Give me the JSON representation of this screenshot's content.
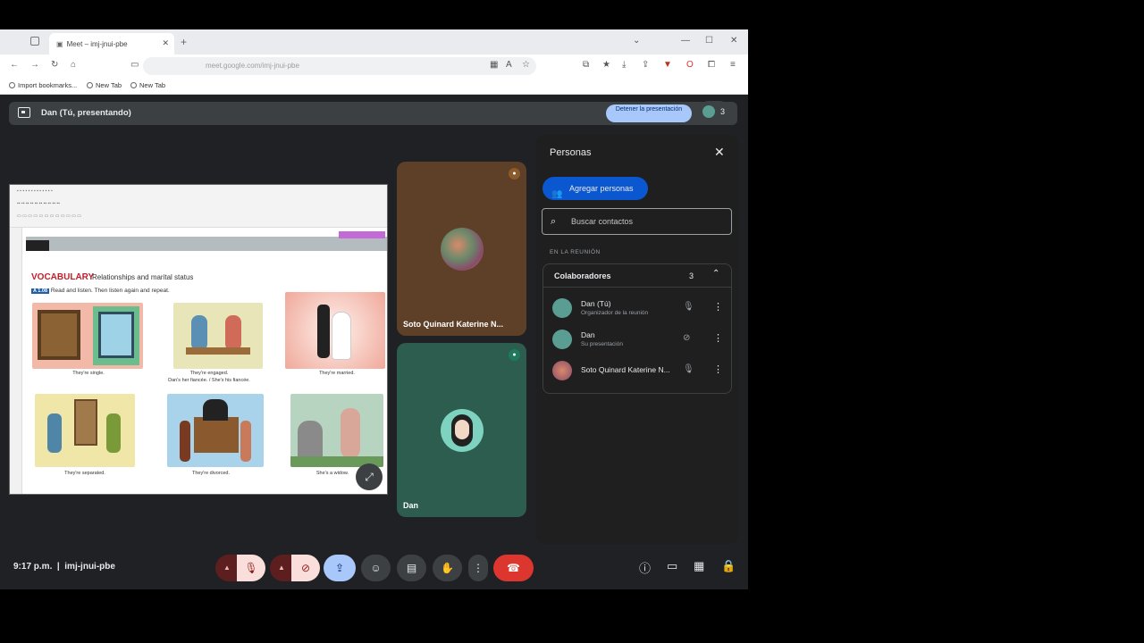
{
  "browser": {
    "tab_title": "Meet – imj-jnui-pbe",
    "url": "meet.google.com/imj-jnui-pbe",
    "bookmarks": [
      "Import bookmarks...",
      "New Tab",
      "New Tab"
    ]
  },
  "meet": {
    "presenting_label": "Dan (Tú, presentando)",
    "stop_button": "Detener la presentación",
    "participant_count": "3",
    "time": "9:17 p.m.",
    "meeting_code": "imj-jnui-pbe"
  },
  "slide": {
    "title": "VOCABULARY",
    "subtitle": "Relationships and marital status",
    "instruction_code": "A 1.08",
    "instruction": "Read and listen. Then listen again and repeat.",
    "captions": [
      "They're single.",
      "They're engaged.",
      "They're married.",
      "They're separated.",
      "They're divorced.",
      "She's a widow."
    ],
    "caption_sub": "Dan's her fiancée. / She's his fiancée."
  },
  "tiles": [
    {
      "name": "Soto Quinard Katerine N...",
      "color": "#5e3f27"
    },
    {
      "name": "Dan",
      "color": "#2c5d4f"
    }
  ],
  "panel": {
    "title": "Personas",
    "add_button": "Agregar personas",
    "search_placeholder": "Buscar contactos",
    "section_label": "EN LA REUNIÓN",
    "group_title": "Colaboradores",
    "group_count": "3",
    "participants": [
      {
        "name": "Dan (Tú)",
        "sub": "Organizador de la reunión"
      },
      {
        "name": "Dan",
        "sub": "Su presentación"
      },
      {
        "name": "Soto Quinard Katerine N...",
        "sub": ""
      }
    ]
  }
}
